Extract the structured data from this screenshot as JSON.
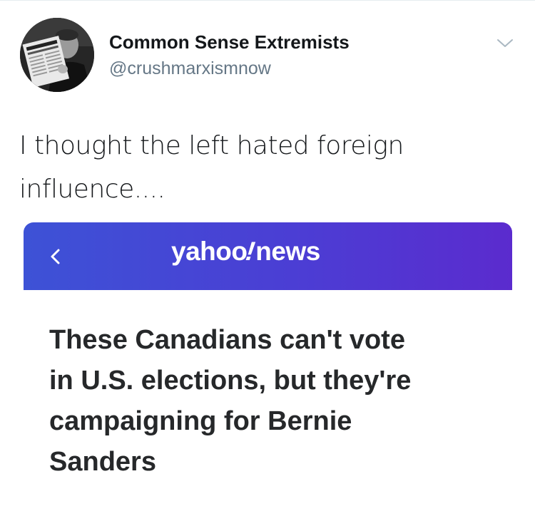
{
  "tweet": {
    "author": {
      "display_name": "Common Sense Extremists",
      "handle": "@crushmarxismnow"
    },
    "text_lines": [
      "I thought the left hated foreign",
      "influence...."
    ],
    "menu_icon": "chevron-down-icon"
  },
  "card": {
    "brand": {
      "name": "yahoo",
      "bang": "!",
      "suffix": "news"
    },
    "back_icon": "chevron-left-icon",
    "headline_lines": [
      "These Canadians can't vote",
      "in U.S. elections, but they're",
      "campaigning for Bernie",
      "Sanders"
    ]
  },
  "colors": {
    "text_primary": "#14171a",
    "text_secondary": "#657786",
    "header_gradient_start": "#3d52d6",
    "header_gradient_end": "#5b2bce",
    "headline": "#26282a"
  }
}
